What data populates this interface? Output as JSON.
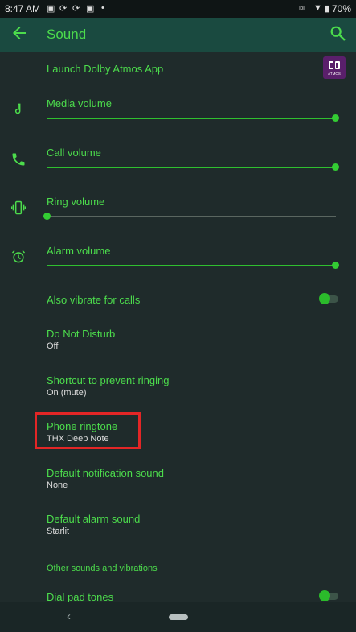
{
  "status_bar": {
    "time": "8:47 AM",
    "battery": "70%"
  },
  "app_bar": {
    "title": "Sound"
  },
  "dolby": {
    "label": "Launch Dolby Atmos App",
    "logo_text": "ATMOS"
  },
  "volumes": {
    "media": {
      "label": "Media volume",
      "level": 1.0
    },
    "call": {
      "label": "Call volume",
      "level": 1.0
    },
    "ring": {
      "label": "Ring volume",
      "level": 0.0
    },
    "alarm": {
      "label": "Alarm volume",
      "level": 1.0
    }
  },
  "vibrate": {
    "label": "Also vibrate for calls"
  },
  "dnd": {
    "title": "Do Not Disturb",
    "subtitle": "Off"
  },
  "shortcut": {
    "title": "Shortcut to prevent ringing",
    "subtitle": "On (mute)"
  },
  "ringtone": {
    "title": "Phone ringtone",
    "subtitle": "THX Deep Note"
  },
  "notification": {
    "title": "Default notification sound",
    "subtitle": "None"
  },
  "alarm_sound": {
    "title": "Default alarm sound",
    "subtitle": "Starlit"
  },
  "section": {
    "other": "Other sounds and vibrations"
  },
  "dialpad": {
    "label": "Dial pad tones"
  },
  "nav": {
    "back_glyph": "‹"
  },
  "colors": {
    "accent": "#4cdc4c",
    "highlight": "#e32626",
    "background": "#1f2b2b"
  }
}
